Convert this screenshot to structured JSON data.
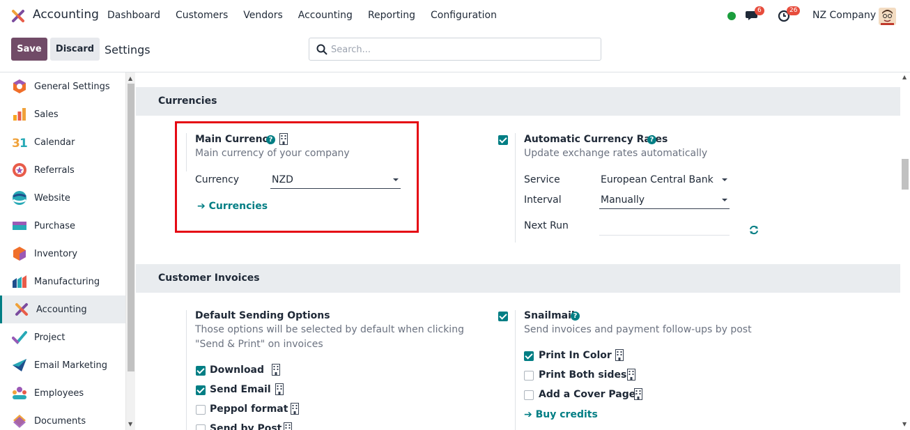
{
  "topbar": {
    "app_name": "Accounting",
    "menu": [
      "Dashboard",
      "Customers",
      "Vendors",
      "Accounting",
      "Reporting",
      "Configuration"
    ],
    "messages_count": "6",
    "activities_count": "26",
    "company": "NZ Company"
  },
  "controls": {
    "save_label": "Save",
    "discard_label": "Discard",
    "title": "Settings",
    "search_placeholder": "Search..."
  },
  "sidebar": {
    "items": [
      {
        "label": "General Settings",
        "icon": "general-settings-icon"
      },
      {
        "label": "Sales",
        "icon": "sales-icon"
      },
      {
        "label": "Calendar",
        "icon": "calendar-icon"
      },
      {
        "label": "Referrals",
        "icon": "referrals-icon"
      },
      {
        "label": "Website",
        "icon": "website-icon"
      },
      {
        "label": "Purchase",
        "icon": "purchase-icon"
      },
      {
        "label": "Inventory",
        "icon": "inventory-icon"
      },
      {
        "label": "Manufacturing",
        "icon": "manufacturing-icon"
      },
      {
        "label": "Accounting",
        "icon": "accounting-icon",
        "active": true
      },
      {
        "label": "Project",
        "icon": "project-icon"
      },
      {
        "label": "Email Marketing",
        "icon": "email-marketing-icon"
      },
      {
        "label": "Employees",
        "icon": "employees-icon"
      },
      {
        "label": "Documents",
        "icon": "documents-icon"
      }
    ]
  },
  "currencies": {
    "heading": "Currencies",
    "main_currency": {
      "title": "Main Currency",
      "description": "Main currency of your company",
      "currency_label": "Currency",
      "currency_value": "NZD",
      "link": "Currencies"
    },
    "auto_rates": {
      "title": "Automatic Currency Rates",
      "description": "Update exchange rates automatically",
      "enabled": true,
      "service_label": "Service",
      "service_value": "European Central Bank",
      "interval_label": "Interval",
      "interval_value": "Manually",
      "next_run_label": "Next Run"
    }
  },
  "customer_invoices": {
    "heading": "Customer Invoices",
    "default_sending": {
      "title": "Default Sending Options",
      "description": "Those options will be selected by default when clicking \"Send & Print\" on invoices",
      "options": [
        {
          "label": "Download",
          "checked": true
        },
        {
          "label": "Send Email",
          "checked": true
        },
        {
          "label": "Peppol format",
          "checked": false
        },
        {
          "label": "Send by Post",
          "checked": false
        }
      ]
    },
    "snailmail": {
      "title": "Snailmail",
      "description": "Send invoices and payment follow-ups by post",
      "enabled": true,
      "options": [
        {
          "label": "Print In Color",
          "checked": true
        },
        {
          "label": "Print Both sides",
          "checked": false
        },
        {
          "label": "Add a Cover Page",
          "checked": false
        }
      ],
      "link": "Buy credits"
    }
  },
  "colors": {
    "brand": "#714b67",
    "accent": "#017e84",
    "highlight_border": "#e50914"
  }
}
